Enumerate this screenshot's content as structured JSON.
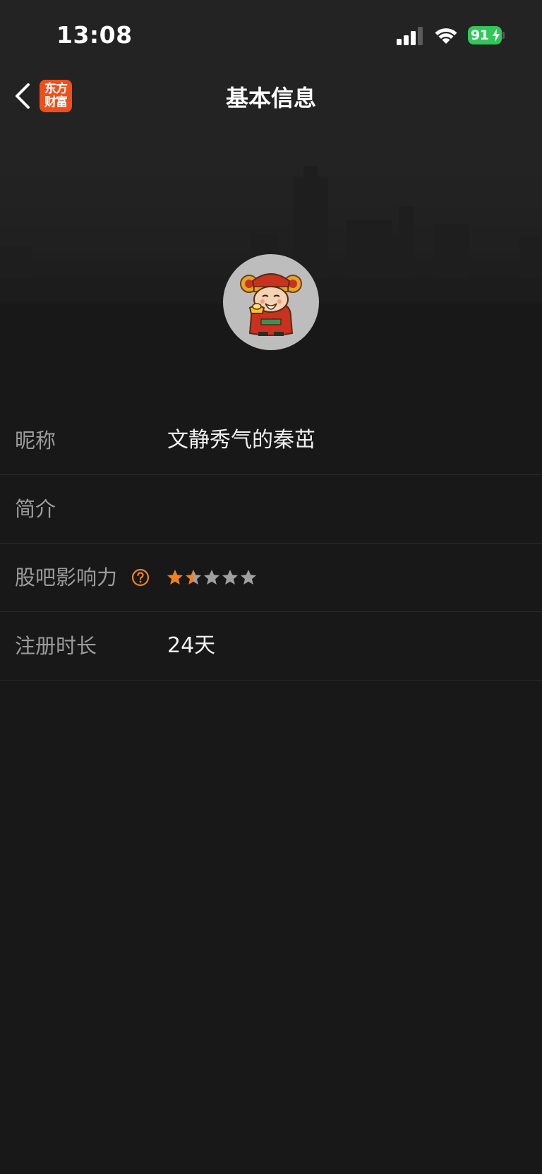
{
  "status_bar": {
    "time": "13:08",
    "battery_level": "91",
    "battery_charging": true,
    "signal_bars": 3,
    "icons": [
      "signal-icon",
      "wifi-icon",
      "battery-icon"
    ]
  },
  "nav": {
    "title": "基本信息",
    "back_icon": "chevron-left-icon",
    "app_logo_line1": "东方",
    "app_logo_line2": "财富"
  },
  "profile": {
    "avatar": "god-of-wealth-avatar"
  },
  "info": {
    "nickname": {
      "label": "昵称",
      "value": "文静秀气的秦茁"
    },
    "bio": {
      "label": "简介",
      "value": ""
    },
    "influence": {
      "label": "股吧影响力",
      "rating": 1.5,
      "max_rating": 5,
      "help_icon": "question-circle-icon"
    },
    "registration": {
      "label": "注册时长",
      "value": "24天"
    }
  },
  "colors": {
    "background": "#181818",
    "header_background": "#232323",
    "accent": "#f0821e",
    "label_text": "#9b9b9b",
    "value_text": "#f0f0f0",
    "battery_green": "#32c759",
    "brand_orange": "#ef4f1b",
    "star_inactive": "#a0a0a0"
  }
}
